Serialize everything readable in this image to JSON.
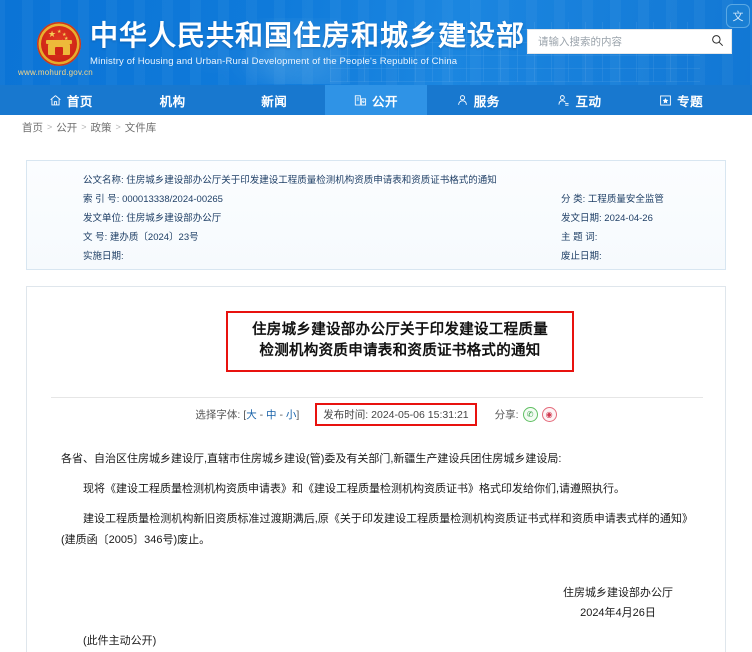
{
  "header": {
    "brand_cn": "中华人民共和国住房和城乡建设部",
    "brand_en": "Ministry of Housing and Urban-Rural Development of the People's Republic of China",
    "url": "www.mohurd.gov.cn",
    "emblem_name": "national-emblem",
    "corner_button_label": "文",
    "colors": {
      "header_blue": "#0f7ada",
      "nav_blue": "#1878cf",
      "nav_active_blue": "#2f93e6"
    }
  },
  "search": {
    "placeholder": "请输入搜索的内容",
    "value": "",
    "icon": "search-icon"
  },
  "nav": {
    "items": [
      {
        "label": "首页",
        "icon": "home-icon",
        "active": false
      },
      {
        "label": "机构",
        "icon": "",
        "active": false
      },
      {
        "label": "新闻",
        "icon": "",
        "active": false
      },
      {
        "label": "公开",
        "icon": "documents-icon",
        "active": true
      },
      {
        "label": "服务",
        "icon": "person-icon",
        "active": false
      },
      {
        "label": "互动",
        "icon": "person-chat-icon",
        "active": false
      },
      {
        "label": "专题",
        "icon": "star-box-icon",
        "active": false
      }
    ]
  },
  "breadcrumb": {
    "items": [
      "首页",
      "公开",
      "政策",
      "文件库"
    ],
    "separator": ">"
  },
  "meta": {
    "left": [
      {
        "label": "公文名称:",
        "value": "住房城乡建设部办公厅关于印发建设工程质量检测机构资质申请表和资质证书格式的通知"
      },
      {
        "label": "索 引 号:",
        "value": "000013338/2024-00265"
      },
      {
        "label": "发文单位:",
        "value": "住房城乡建设部办公厅"
      },
      {
        "label": "文     号:",
        "value": "建办质〔2024〕23号"
      },
      {
        "label": "实施日期:",
        "value": ""
      }
    ],
    "right": [
      {
        "label": "分     类:",
        "value": "工程质量安全监管"
      },
      {
        "label": "发文日期:",
        "value": "2024-04-26"
      },
      {
        "label": "主 题 词:",
        "value": ""
      },
      {
        "label": "废止日期:",
        "value": ""
      }
    ]
  },
  "document": {
    "title_line1": "住房城乡建设部办公厅关于印发建设工程质量",
    "title_line2": "检测机构资质申请表和资质证书格式的通知",
    "title_highlight_color": "#e8120f",
    "toolbar": {
      "font_label": "选择字体:",
      "font_bracket_open": "[",
      "font_large": "大",
      "font_medium": "中",
      "font_small": "小",
      "font_bracket_close": "]",
      "font_sep": "-",
      "publish_label": "发布时间:",
      "publish_time": "2024-05-06 15:31:21",
      "publish_highlight_color": "#e8120f",
      "share_label": "分享:",
      "share_icons": [
        "wechat-share-icon",
        "weibo-share-icon"
      ]
    },
    "paragraphs": [
      "各省、自治区住房城乡建设厅,直辖市住房城乡建设(管)委及有关部门,新疆生产建设兵团住房城乡建设局:",
      "现将《建设工程质量检测机构资质申请表》和《建设工程质量检测机构资质证书》格式印发给你们,请遵照执行。",
      "建设工程质量检测机构新旧资质标准过渡期满后,原《关于印发建设工程质量检测机构资质证书式样和资质申请表式样的通知》(建质函〔2005〕346号)废止。"
    ],
    "signature_org": "住房城乡建设部办公厅",
    "signature_date": "2024年4月26日",
    "footnote": "(此件主动公开)"
  }
}
